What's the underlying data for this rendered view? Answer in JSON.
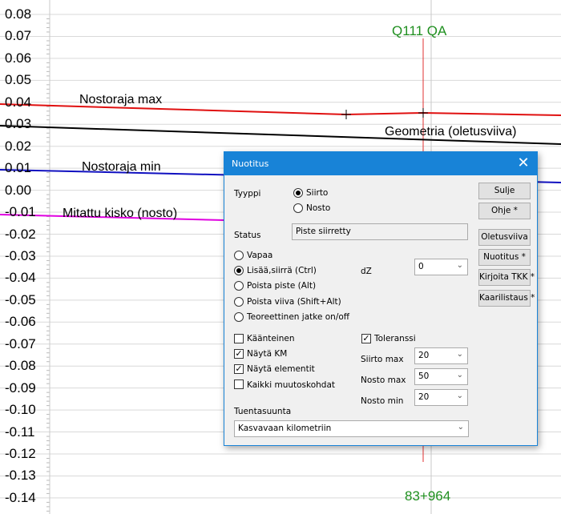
{
  "chart_data": {
    "type": "line",
    "ylim": [
      -0.14,
      0.08
    ],
    "yticks": [
      "0.08",
      "0.07",
      "0.06",
      "0.05",
      "0.04",
      "0.03",
      "0.02",
      "0.01",
      "0.00",
      "-0.01",
      "-0.02",
      "-0.03",
      "-0.04",
      "-0.05",
      "-0.06",
      "-0.07",
      "-0.08",
      "-0.09",
      "-0.10",
      "-0.11",
      "-0.12",
      "-0.13",
      "-0.14"
    ],
    "series": [
      {
        "name": "Nostoraja max",
        "color": "#e01010"
      },
      {
        "name": "Geometria (oletusviiva)",
        "color": "#000000"
      },
      {
        "name": "Nostoraja min",
        "color": "#1010c0"
      },
      {
        "name": "Mitattu kisko (nosto)",
        "color": "#e000e0"
      }
    ],
    "markers": {
      "top": "Q111 QA",
      "bottom": "83+964"
    }
  },
  "dialog": {
    "title": "Nuotitus",
    "close_symbol": "✕",
    "tyyppi_label": "Tyyppi",
    "tyyppi_options": [
      "Siirto",
      "Nosto"
    ],
    "status_label": "Status",
    "status_value": "Piste siirretty",
    "modes": [
      "Vapaa",
      "Lisää,siirrä  (Ctrl)",
      "Poista piste  (Alt)",
      "Poista viiva  (Shift+Alt)",
      "Teoreettinen jatke on/off"
    ],
    "dz_label": "dZ",
    "dz_value": "0",
    "checks": [
      "Käänteinen",
      "Näytä KM",
      "Näytä elementit",
      "Kaikki muutoskohdat"
    ],
    "toleranssi_label": "Toleranssi",
    "siirto_max_label": "Siirto max",
    "siirto_max_value": "20",
    "nosto_max_label": "Nosto max",
    "nosto_max_value": "50",
    "nosto_min_label": "Nosto min",
    "nosto_min_value": "20",
    "tuentasuunta_label": "Tuentasuunta",
    "tuentasuunta_value": "Kasvavaan kilometriin",
    "buttons": [
      "Sulje",
      "Ohje *",
      "Oletusviiva",
      "Nuotitus *",
      "Kirjoita TKK *",
      "Kaarilistaus *"
    ]
  }
}
